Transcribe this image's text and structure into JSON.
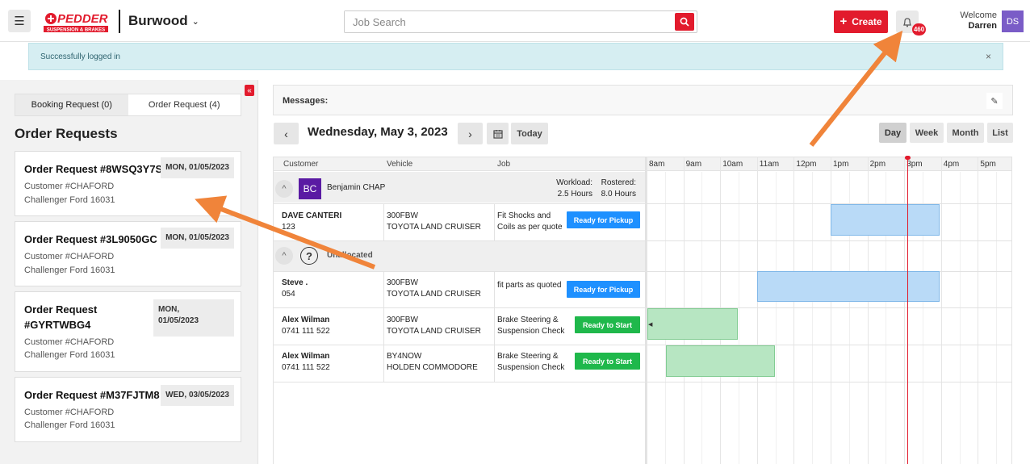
{
  "header": {
    "logo_text": "PEDDERS",
    "logo_sub": "SUSPENSION & BRAKES",
    "branch": "Burwood",
    "search_placeholder": "Job Search",
    "create_label": "Create",
    "notification_count": "460",
    "welcome_label": "Welcome",
    "user_name": "Darren",
    "user_initials": "DS"
  },
  "alert": {
    "message": "Successfully logged in",
    "close": "×"
  },
  "left": {
    "tabs": [
      {
        "label": "Booking Request (0)"
      },
      {
        "label": "Order Request (4)"
      }
    ],
    "title": "Order Requests",
    "cards": [
      {
        "title": "Order Request #8WSQ3Y7S",
        "date": "MON, 01/05/2023",
        "customer": "Customer #CHAFORD",
        "company": "Challenger Ford 16031"
      },
      {
        "title": "Order Request #3L9050GC",
        "date": "MON, 01/05/2023",
        "customer": "Customer #CHAFORD",
        "company": "Challenger Ford 16031"
      },
      {
        "title_line1": "Order Request",
        "title_line2": "#GYRTWBG4",
        "date_line1": "MON,",
        "date_line2": "01/05/2023",
        "customer": "Customer #CHAFORD",
        "company": "Challenger Ford 16031"
      },
      {
        "title": "Order Request #M37FJTM8",
        "date": "WED, 03/05/2023",
        "customer": "Customer #CHAFORD",
        "company": "Challenger Ford 16031"
      }
    ]
  },
  "main": {
    "messages_label": "Messages:",
    "date_title": "Wednesday, May 3, 2023",
    "today_label": "Today",
    "views": [
      {
        "label": "Day"
      },
      {
        "label": "Week"
      },
      {
        "label": "Month"
      },
      {
        "label": "List"
      }
    ],
    "columns": {
      "customer": "Customer",
      "vehicle": "Vehicle",
      "job": "Job"
    },
    "hours": [
      "8am",
      "9am",
      "10am",
      "11am",
      "12pm",
      "1pm",
      "2pm",
      "3pm",
      "4pm",
      "5pm"
    ],
    "groups": [
      {
        "initials": "BC",
        "name": "Benjamin CHAP",
        "workload_label": "Workload:",
        "workload_value": "2.5 Hours",
        "rostered_label": "Rostered:",
        "rostered_value": "8.0 Hours"
      },
      {
        "name": "Unallocated"
      }
    ],
    "jobs": [
      {
        "customer": "DAVE CANTERI",
        "phone": "123",
        "rego": "300FBW",
        "vehicle": "TOYOTA LAND CRUISER",
        "job1": "Fit Shocks and",
        "job2": "Coils as per quote",
        "status": "Ready for Pickup"
      },
      {
        "customer": "Steve .",
        "phone": "054",
        "rego": "300FBW",
        "vehicle": "TOYOTA LAND CRUISER",
        "job1": "fit parts as quoted",
        "job2": "",
        "status": "Ready for Pickup"
      },
      {
        "customer": "Alex Wilman",
        "phone": "0741 111 522",
        "rego": "300FBW",
        "vehicle": "TOYOTA LAND CRUISER",
        "job1": "Brake Steering &",
        "job2": "Suspension Check",
        "status": "Ready to Start"
      },
      {
        "customer": "Alex Wilman",
        "phone": "0741 111 522",
        "rego": "BY4NOW",
        "vehicle": "HOLDEN COMMODORE",
        "job1": "Brake Steering &",
        "job2": "Suspension Check",
        "status": "Ready to Start"
      }
    ],
    "colors": {
      "accent": "#e21b2d",
      "pickup": "#1e90ff",
      "start": "#1fb84b",
      "annotation": "#f0843a"
    }
  }
}
